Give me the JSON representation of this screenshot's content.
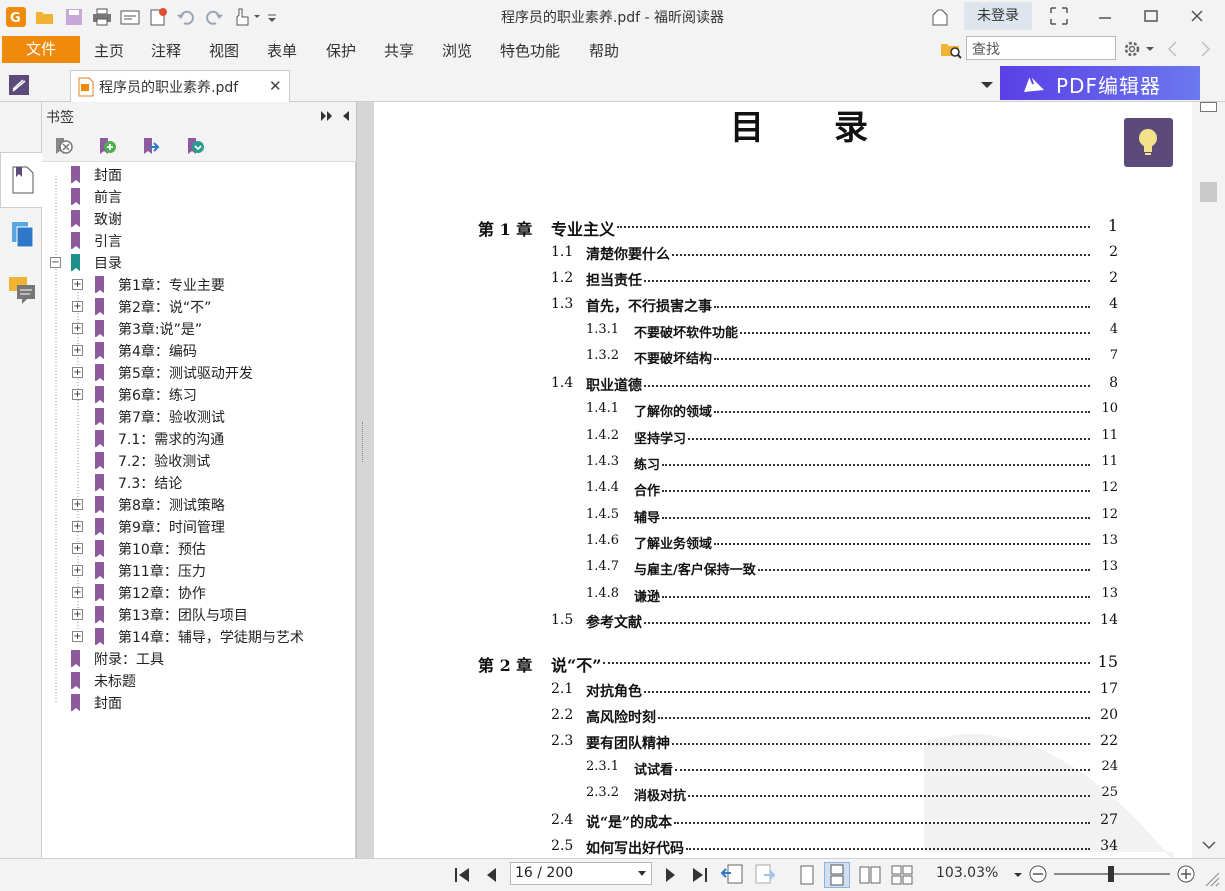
{
  "window": {
    "title": "程序员的职业素养.pdf - 福昕阅读器",
    "login_label": "未登录"
  },
  "menu": {
    "file": "文件",
    "items": [
      "主页",
      "注释",
      "视图",
      "表单",
      "保护",
      "共享",
      "浏览",
      "特色功能",
      "帮助"
    ]
  },
  "search": {
    "placeholder": "查找"
  },
  "tab": {
    "label": "程序员的职业素养.pdf"
  },
  "promo": {
    "label": "PDF编辑器"
  },
  "bookmarks": {
    "header": "书签",
    "items": [
      {
        "label": "封面",
        "level": 0,
        "expander": "none"
      },
      {
        "label": "前言",
        "level": 0,
        "expander": "none"
      },
      {
        "label": "致谢",
        "level": 0,
        "expander": "none"
      },
      {
        "label": "引言",
        "level": 0,
        "expander": "none"
      },
      {
        "label": "目录",
        "level": 0,
        "expander": "minus"
      },
      {
        "label": "第1章：专业主要",
        "level": 1,
        "expander": "plus"
      },
      {
        "label": "第2章：说“不”",
        "level": 1,
        "expander": "plus"
      },
      {
        "label": "第3章:说”是”",
        "level": 1,
        "expander": "plus"
      },
      {
        "label": "第4章：编码",
        "level": 1,
        "expander": "plus"
      },
      {
        "label": "第5章：测试驱动开发",
        "level": 1,
        "expander": "plus"
      },
      {
        "label": "第6章：练习",
        "level": 1,
        "expander": "plus"
      },
      {
        "label": "第7章：验收测试",
        "level": 1,
        "expander": "none"
      },
      {
        "label": "7.1：需求的沟通",
        "level": 1,
        "expander": "none"
      },
      {
        "label": "7.2：验收测试",
        "level": 1,
        "expander": "none"
      },
      {
        "label": "7.3：结论",
        "level": 1,
        "expander": "none"
      },
      {
        "label": "第8章：测试策略",
        "level": 1,
        "expander": "plus"
      },
      {
        "label": "第9章：时间管理",
        "level": 1,
        "expander": "plus"
      },
      {
        "label": "第10章：预估",
        "level": 1,
        "expander": "plus"
      },
      {
        "label": "第11章：压力",
        "level": 1,
        "expander": "plus"
      },
      {
        "label": "第12章：协作",
        "level": 1,
        "expander": "plus"
      },
      {
        "label": "第13章：团队与项目",
        "level": 1,
        "expander": "plus"
      },
      {
        "label": "第14章：辅导，学徒期与艺术",
        "level": 1,
        "expander": "plus"
      },
      {
        "label": "附录：工具",
        "level": 0,
        "expander": "none"
      },
      {
        "label": "未标题",
        "level": 0,
        "expander": "none"
      },
      {
        "label": "封面",
        "level": 0,
        "expander": "none"
      }
    ]
  },
  "document": {
    "toc_heading": "目录",
    "entries": [
      {
        "num": "第 1 章",
        "title": "专业主义",
        "page": "1",
        "kind": "chapter"
      },
      {
        "num": "1.1",
        "title": "清楚你要什么",
        "page": "2",
        "kind": "section"
      },
      {
        "num": "1.2",
        "title": "担当责任",
        "page": "2",
        "kind": "section"
      },
      {
        "num": "1.3",
        "title": "首先，不行损害之事",
        "page": "4",
        "kind": "section"
      },
      {
        "num": "1.3.1",
        "title": "不要破坏软件功能",
        "page": "4",
        "kind": "sub"
      },
      {
        "num": "1.3.2",
        "title": "不要破坏结构",
        "page": "7",
        "kind": "sub"
      },
      {
        "num": "1.4",
        "title": "职业道德",
        "page": "8",
        "kind": "section"
      },
      {
        "num": "1.4.1",
        "title": "了解你的领域",
        "page": "10",
        "kind": "sub"
      },
      {
        "num": "1.4.2",
        "title": "坚持学习",
        "page": "11",
        "kind": "sub"
      },
      {
        "num": "1.4.3",
        "title": "练习",
        "page": "11",
        "kind": "sub"
      },
      {
        "num": "1.4.4",
        "title": "合作",
        "page": "12",
        "kind": "sub"
      },
      {
        "num": "1.4.5",
        "title": "辅导",
        "page": "12",
        "kind": "sub"
      },
      {
        "num": "1.4.6",
        "title": "了解业务领域",
        "page": "13",
        "kind": "sub"
      },
      {
        "num": "1.4.7",
        "title": "与雇主/客户保持一致",
        "page": "13",
        "kind": "sub"
      },
      {
        "num": "1.4.8",
        "title": "谦逊",
        "page": "13",
        "kind": "sub"
      },
      {
        "num": "1.5",
        "title": "参考文献",
        "page": "14",
        "kind": "section"
      },
      {
        "num": "第 2 章",
        "title": "说“不”",
        "page": "15",
        "kind": "chapter"
      },
      {
        "num": "2.1",
        "title": "对抗角色",
        "page": "17",
        "kind": "section"
      },
      {
        "num": "2.2",
        "title": "高风险时刻",
        "page": "20",
        "kind": "section"
      },
      {
        "num": "2.3",
        "title": "要有团队精神",
        "page": "22",
        "kind": "section"
      },
      {
        "num": "2.3.1",
        "title": "试试看",
        "page": "24",
        "kind": "sub"
      },
      {
        "num": "2.3.2",
        "title": "消极对抗",
        "page": "25",
        "kind": "sub"
      },
      {
        "num": "2.4",
        "title": "说“是”的成本",
        "page": "27",
        "kind": "section"
      },
      {
        "num": "2.5",
        "title": "如何写出好代码",
        "page": "34",
        "kind": "section"
      }
    ]
  },
  "status": {
    "page_indicator": "16 / 200",
    "zoom": "103.03%"
  },
  "colors": {
    "accent_orange": "#f08a0c",
    "bookmark_purple": "#8e5a9e",
    "bookmark_teal": "#1f8f8a",
    "promo_purple": "#5a3fe6"
  }
}
